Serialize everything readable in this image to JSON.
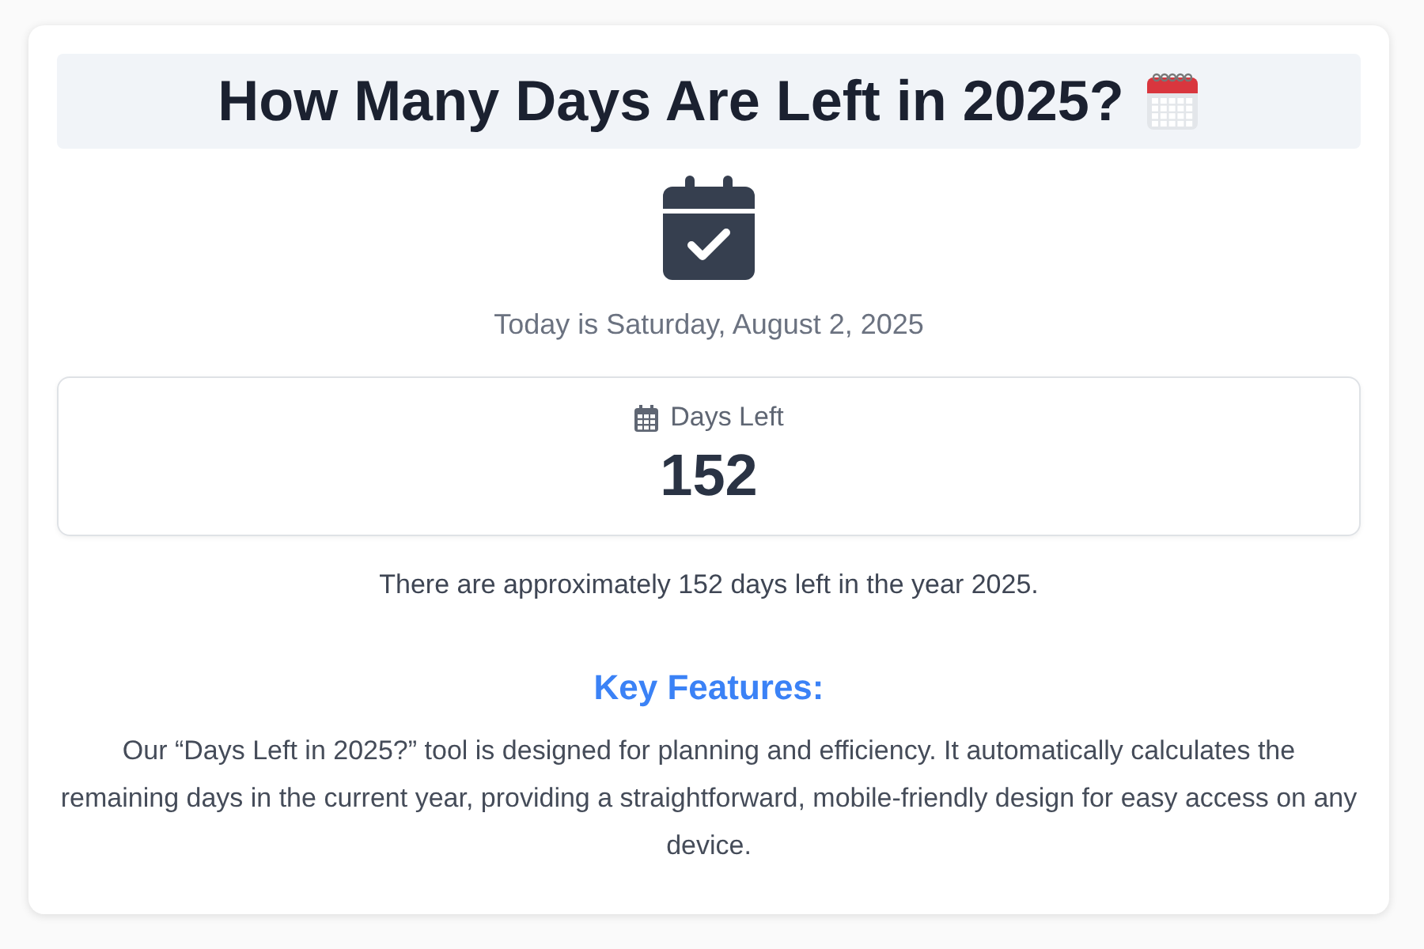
{
  "title": "How Many Days Are Left in 2025?",
  "today": "Today is Saturday, August 2, 2025",
  "counter": {
    "label": "Days Left",
    "value": "152"
  },
  "summary": "There are approximately 152 days left in the year 2025.",
  "features": {
    "heading": "Key Features:",
    "text": "Our “Days Left in 2025?” tool is designed for planning and efficiency. It automatically calculates the remaining days in the current year, providing a straightforward, mobile-friendly design for easy access on any device."
  }
}
